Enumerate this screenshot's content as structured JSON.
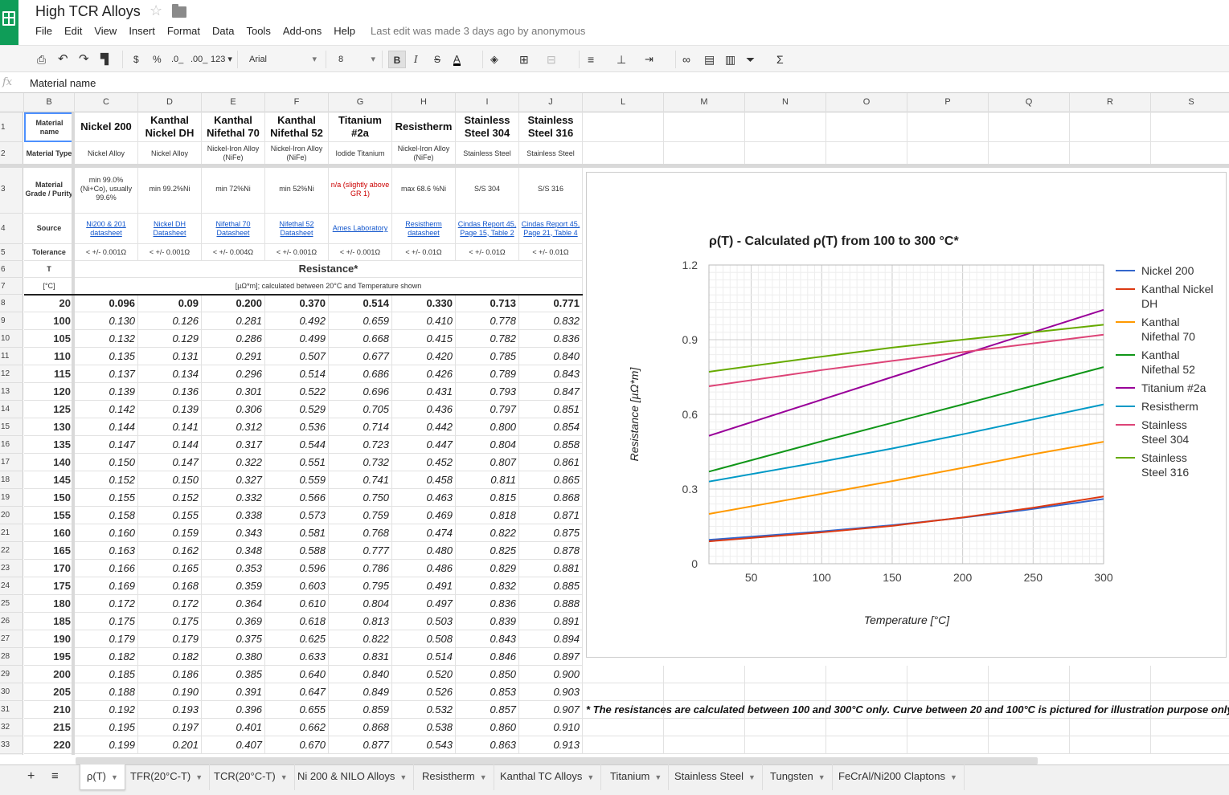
{
  "doc": {
    "title": "High TCR Alloys",
    "last_edit": "Last edit was made 3 days ago by anonymous"
  },
  "menu": [
    "File",
    "Edit",
    "View",
    "Insert",
    "Format",
    "Data",
    "Tools",
    "Add-ons",
    "Help"
  ],
  "toolbar": {
    "currency": "$",
    "percent": "%",
    "dec_less": ".0_",
    "dec_more": ".00_",
    "more_formats": "123",
    "font": "Arial",
    "font_size": "8",
    "bold": "B",
    "italic": "I",
    "strike": "S",
    "text_color": "A",
    "function": "Σ"
  },
  "formula_bar": {
    "fx": "fx",
    "value": "Material name"
  },
  "columns": [
    "B",
    "C",
    "D",
    "E",
    "F",
    "G",
    "H",
    "I",
    "J",
    "L",
    "M",
    "N",
    "O",
    "P",
    "Q",
    "R",
    "S"
  ],
  "row_numbers": [
    "1",
    "2",
    "3",
    "4",
    "5",
    "6",
    "7",
    "8",
    "9",
    "10",
    "11",
    "12",
    "13",
    "14",
    "15",
    "16",
    "17",
    "18",
    "19",
    "20",
    "21",
    "22",
    "23",
    "24",
    "25",
    "26",
    "27",
    "28",
    "29",
    "30",
    "31",
    "32",
    "33"
  ],
  "labels": {
    "material_name": "Material name",
    "material_type": "Material Type",
    "grade": "Material Grade / Purity",
    "source": "Source",
    "tolerance": "Tolerance",
    "t": "T",
    "t_unit": "[°C]",
    "resistance": "Resistance*",
    "res_sub": "[µΩ*m]; calculated between 20°C and Temperature shown"
  },
  "materials": [
    {
      "name": "Nickel 200",
      "type": "Nickel Alloy",
      "grade": "min 99.0% (Ni+Co), usually 99.6%",
      "source": "Ni200 & 201 datasheet",
      "tol": "< +/- 0.001Ω",
      "r20": "0.096"
    },
    {
      "name": "Kanthal Nickel DH",
      "type": "Nickel Alloy",
      "grade": "min 99.2%Ni",
      "source": "Nickel DH Datasheet",
      "tol": "< +/- 0.001Ω",
      "r20": "0.09"
    },
    {
      "name": "Kanthal Nifethal 70",
      "type": "Nickel-Iron Alloy (NiFe)",
      "grade": "min 72%Ni",
      "source": "Nifethal 70 Datasheet",
      "tol": "< +/- 0.004Ω",
      "r20": "0.200"
    },
    {
      "name": "Kanthal Nifethal 52",
      "type": "Nickel-Iron Alloy (NiFe)",
      "grade": "min 52%Ni",
      "source": "Nifethal 52 Datasheet",
      "tol": "< +/- 0.001Ω",
      "r20": "0.370"
    },
    {
      "name": "Titanium #2a",
      "type": "Iodide Titanium",
      "grade": "n/a (slightly above GR 1)",
      "source": "Ames Laboratory",
      "tol": "< +/- 0.001Ω",
      "r20": "0.514"
    },
    {
      "name": "Resistherm",
      "type": "Nickel-Iron Alloy (NiFe)",
      "grade": "max 68.6 %Ni",
      "source": "Resistherm datasheet",
      "tol": "< +/- 0.01Ω",
      "r20": "0.330"
    },
    {
      "name": "Stainless Steel 304",
      "type": "Stainless Steel",
      "grade": "S/S 304",
      "source": "Cindas Report 45, Page 15, Table 2",
      "tol": "< +/- 0.01Ω",
      "r20": "0.713"
    },
    {
      "name": "Stainless Steel 316",
      "type": "Stainless Steel",
      "grade": "S/S 316",
      "source": "Cindas Report 45, Page 21, Table 4",
      "tol": "< +/- 0.01Ω",
      "r20": "0.771"
    }
  ],
  "table": {
    "temps": [
      "20",
      "100",
      "105",
      "110",
      "115",
      "120",
      "125",
      "130",
      "135",
      "140",
      "145",
      "150",
      "155",
      "160",
      "165",
      "170",
      "175",
      "180",
      "185",
      "190",
      "195",
      "200",
      "205",
      "210",
      "215",
      "220"
    ],
    "rows": [
      [
        "0.130",
        "0.126",
        "0.281",
        "0.492",
        "0.659",
        "0.410",
        "0.778",
        "0.832"
      ],
      [
        "0.132",
        "0.129",
        "0.286",
        "0.499",
        "0.668",
        "0.415",
        "0.782",
        "0.836"
      ],
      [
        "0.135",
        "0.131",
        "0.291",
        "0.507",
        "0.677",
        "0.420",
        "0.785",
        "0.840"
      ],
      [
        "0.137",
        "0.134",
        "0.296",
        "0.514",
        "0.686",
        "0.426",
        "0.789",
        "0.843"
      ],
      [
        "0.139",
        "0.136",
        "0.301",
        "0.522",
        "0.696",
        "0.431",
        "0.793",
        "0.847"
      ],
      [
        "0.142",
        "0.139",
        "0.306",
        "0.529",
        "0.705",
        "0.436",
        "0.797",
        "0.851"
      ],
      [
        "0.144",
        "0.141",
        "0.312",
        "0.536",
        "0.714",
        "0.442",
        "0.800",
        "0.854"
      ],
      [
        "0.147",
        "0.144",
        "0.317",
        "0.544",
        "0.723",
        "0.447",
        "0.804",
        "0.858"
      ],
      [
        "0.150",
        "0.147",
        "0.322",
        "0.551",
        "0.732",
        "0.452",
        "0.807",
        "0.861"
      ],
      [
        "0.152",
        "0.150",
        "0.327",
        "0.559",
        "0.741",
        "0.458",
        "0.811",
        "0.865"
      ],
      [
        "0.155",
        "0.152",
        "0.332",
        "0.566",
        "0.750",
        "0.463",
        "0.815",
        "0.868"
      ],
      [
        "0.158",
        "0.155",
        "0.338",
        "0.573",
        "0.759",
        "0.469",
        "0.818",
        "0.871"
      ],
      [
        "0.160",
        "0.159",
        "0.343",
        "0.581",
        "0.768",
        "0.474",
        "0.822",
        "0.875"
      ],
      [
        "0.163",
        "0.162",
        "0.348",
        "0.588",
        "0.777",
        "0.480",
        "0.825",
        "0.878"
      ],
      [
        "0.166",
        "0.165",
        "0.353",
        "0.596",
        "0.786",
        "0.486",
        "0.829",
        "0.881"
      ],
      [
        "0.169",
        "0.168",
        "0.359",
        "0.603",
        "0.795",
        "0.491",
        "0.832",
        "0.885"
      ],
      [
        "0.172",
        "0.172",
        "0.364",
        "0.610",
        "0.804",
        "0.497",
        "0.836",
        "0.888"
      ],
      [
        "0.175",
        "0.175",
        "0.369",
        "0.618",
        "0.813",
        "0.503",
        "0.839",
        "0.891"
      ],
      [
        "0.179",
        "0.179",
        "0.375",
        "0.625",
        "0.822",
        "0.508",
        "0.843",
        "0.894"
      ],
      [
        "0.182",
        "0.182",
        "0.380",
        "0.633",
        "0.831",
        "0.514",
        "0.846",
        "0.897"
      ],
      [
        "0.185",
        "0.186",
        "0.385",
        "0.640",
        "0.840",
        "0.520",
        "0.850",
        "0.900"
      ],
      [
        "0.188",
        "0.190",
        "0.391",
        "0.647",
        "0.849",
        "0.526",
        "0.853",
        "0.903"
      ],
      [
        "0.192",
        "0.193",
        "0.396",
        "0.655",
        "0.859",
        "0.532",
        "0.857",
        "0.907"
      ],
      [
        "0.195",
        "0.197",
        "0.401",
        "0.662",
        "0.868",
        "0.538",
        "0.860",
        "0.910"
      ],
      [
        "0.199",
        "0.201",
        "0.407",
        "0.670",
        "0.877",
        "0.543",
        "0.863",
        "0.913"
      ]
    ]
  },
  "footnote": "* The resistances are calculated between 100 and 300°C only. Curve between 20 and 100°C is pictured for illustration purpose only",
  "chart_data": {
    "type": "line",
    "title": "ρ(T) - Calculated ρ(T) from 100 to 300 °C*",
    "xlabel": "Temperature [°C]",
    "ylabel": "Resistance [µΩ*m]",
    "xlim": [
      20,
      300
    ],
    "ylim": [
      0,
      1.2
    ],
    "xticks": [
      50,
      100,
      150,
      200,
      250,
      300
    ],
    "yticks": [
      "0",
      "0.3",
      "0.6",
      "0.9",
      "1.2"
    ],
    "grid": true,
    "legend": "right",
    "x": [
      20,
      100,
      150,
      200,
      250,
      300
    ],
    "series": [
      {
        "name": "Nickel 200",
        "color": "#3366cc",
        "values": [
          0.096,
          0.13,
          0.155,
          0.185,
          0.22,
          0.26
        ]
      },
      {
        "name": "Kanthal Nickel DH",
        "color": "#dc3912",
        "values": [
          0.09,
          0.126,
          0.152,
          0.186,
          0.225,
          0.27
        ]
      },
      {
        "name": "Kanthal Nifethal 70",
        "color": "#ff9900",
        "values": [
          0.2,
          0.281,
          0.332,
          0.385,
          0.44,
          0.49
        ]
      },
      {
        "name": "Kanthal Nifethal 52",
        "color": "#109618",
        "values": [
          0.37,
          0.492,
          0.566,
          0.64,
          0.715,
          0.79
        ]
      },
      {
        "name": "Titanium #2a",
        "color": "#990099",
        "values": [
          0.514,
          0.659,
          0.75,
          0.84,
          0.93,
          1.02
        ]
      },
      {
        "name": "Resistherm",
        "color": "#0099c6",
        "values": [
          0.33,
          0.41,
          0.463,
          0.52,
          0.58,
          0.64
        ]
      },
      {
        "name": "Stainless Steel 304",
        "color": "#dd4477",
        "values": [
          0.713,
          0.778,
          0.815,
          0.85,
          0.885,
          0.92
        ]
      },
      {
        "name": "Stainless Steel 316",
        "color": "#66aa00",
        "values": [
          0.771,
          0.832,
          0.868,
          0.9,
          0.93,
          0.96
        ]
      }
    ]
  },
  "sheets": [
    "ρ(T)",
    "TFR(20°C-T)",
    "TCR(20°C-T)",
    "Ni 200 & NILO Alloys",
    "Resistherm",
    "Kanthal TC Alloys",
    "Titanium",
    "Stainless Steel",
    "Tungsten",
    "FeCrAl/Ni200 Claptons"
  ],
  "colors": {
    "accent": "#0f9d58",
    "link": "#1155cc",
    "grade_red": "#cc0000"
  }
}
